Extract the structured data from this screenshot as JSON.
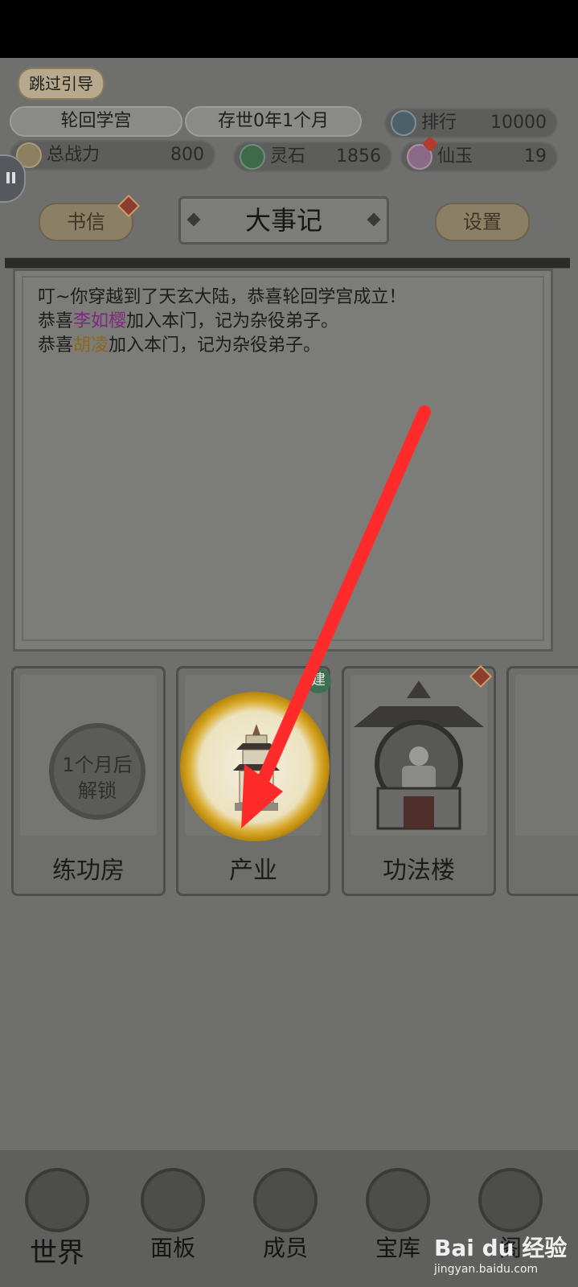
{
  "skip_guide": "跳过引导",
  "header": {
    "sect_name": "轮回学宫",
    "age": "存世0年1个月",
    "rank_label": "排行",
    "rank_value": "10000",
    "power_label": "总战力",
    "power_value": "800",
    "spirit_stone_label": "灵石",
    "spirit_stone_value": "1856",
    "jade_label": "仙玉",
    "jade_value": "19"
  },
  "tabs": {
    "letters": "书信",
    "title": "大事记",
    "settings": "设置"
  },
  "log": {
    "line1": "叮~你穿越到了天玄大陆，恭喜轮回学宫成立！",
    "line2_prefix": "恭喜",
    "line2_name": "李如樱",
    "line2_suffix": "加入本门，记为杂役弟子。",
    "line3_prefix": "恭喜",
    "line3_name": "胡凌",
    "line3_suffix": "加入本门，记为杂役弟子。"
  },
  "buildings": [
    {
      "label": "练功房",
      "lock_line1": "1个月后",
      "lock_line2": "解锁"
    },
    {
      "label": "产业",
      "tag": "建"
    },
    {
      "label": "功法楼"
    },
    {
      "label": ""
    }
  ],
  "nav": {
    "world": "世界",
    "panel": "面板",
    "members": "成员",
    "vault": "宝库",
    "more": "阁"
  },
  "watermark": {
    "main": "Bai du 经验",
    "sub": "jingyan.baidu.com"
  },
  "colors": {
    "overlay": "#6f6f6d",
    "arrow": "#ff2a2a",
    "highlight_gold": "#d9aa2c",
    "name_purple": "#7d2a7e",
    "name_gold": "#8a6a1c"
  }
}
